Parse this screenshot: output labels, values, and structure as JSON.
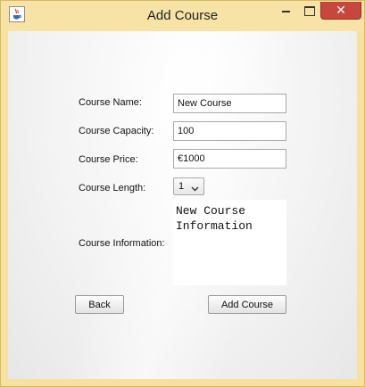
{
  "window": {
    "title": "Add Course",
    "app_icon": "java-icon",
    "close_glyph": "✕"
  },
  "form": {
    "course_name_label": "Course Name:",
    "course_name_value": "New Course",
    "course_capacity_label": "Course Capacity:",
    "course_capacity_value": "100",
    "course_price_label": "Course Price:",
    "course_price_value": "€1000",
    "course_length_label": "Course Length:",
    "course_length_value": "1",
    "course_information_label": "Course Information:",
    "course_information_value": "New Course\nInformation"
  },
  "buttons": {
    "back_label": "Back",
    "add_course_label": "Add Course"
  },
  "colors": {
    "title_bar": "#f7e3a6",
    "close_button": "#c7473f"
  }
}
